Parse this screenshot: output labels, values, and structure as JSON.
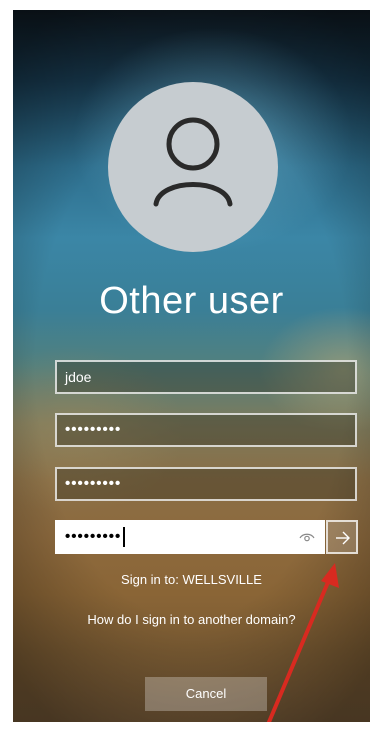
{
  "login": {
    "user_title": "Other user",
    "username_value": "jdoe",
    "password_1_value": "•••••••••",
    "password_2_value": "•••••••••",
    "password_3_value": "•••••••••",
    "sign_in_to": "Sign in to: WELLSVILLE",
    "domain_help_link": "How do I sign in to another domain?",
    "cancel_label": "Cancel"
  },
  "icons": {
    "avatar": "user-silhouette-icon",
    "reveal": "eye-icon",
    "submit": "arrow-right-icon"
  },
  "annotation": {
    "arrow_color": "#d82a20"
  }
}
